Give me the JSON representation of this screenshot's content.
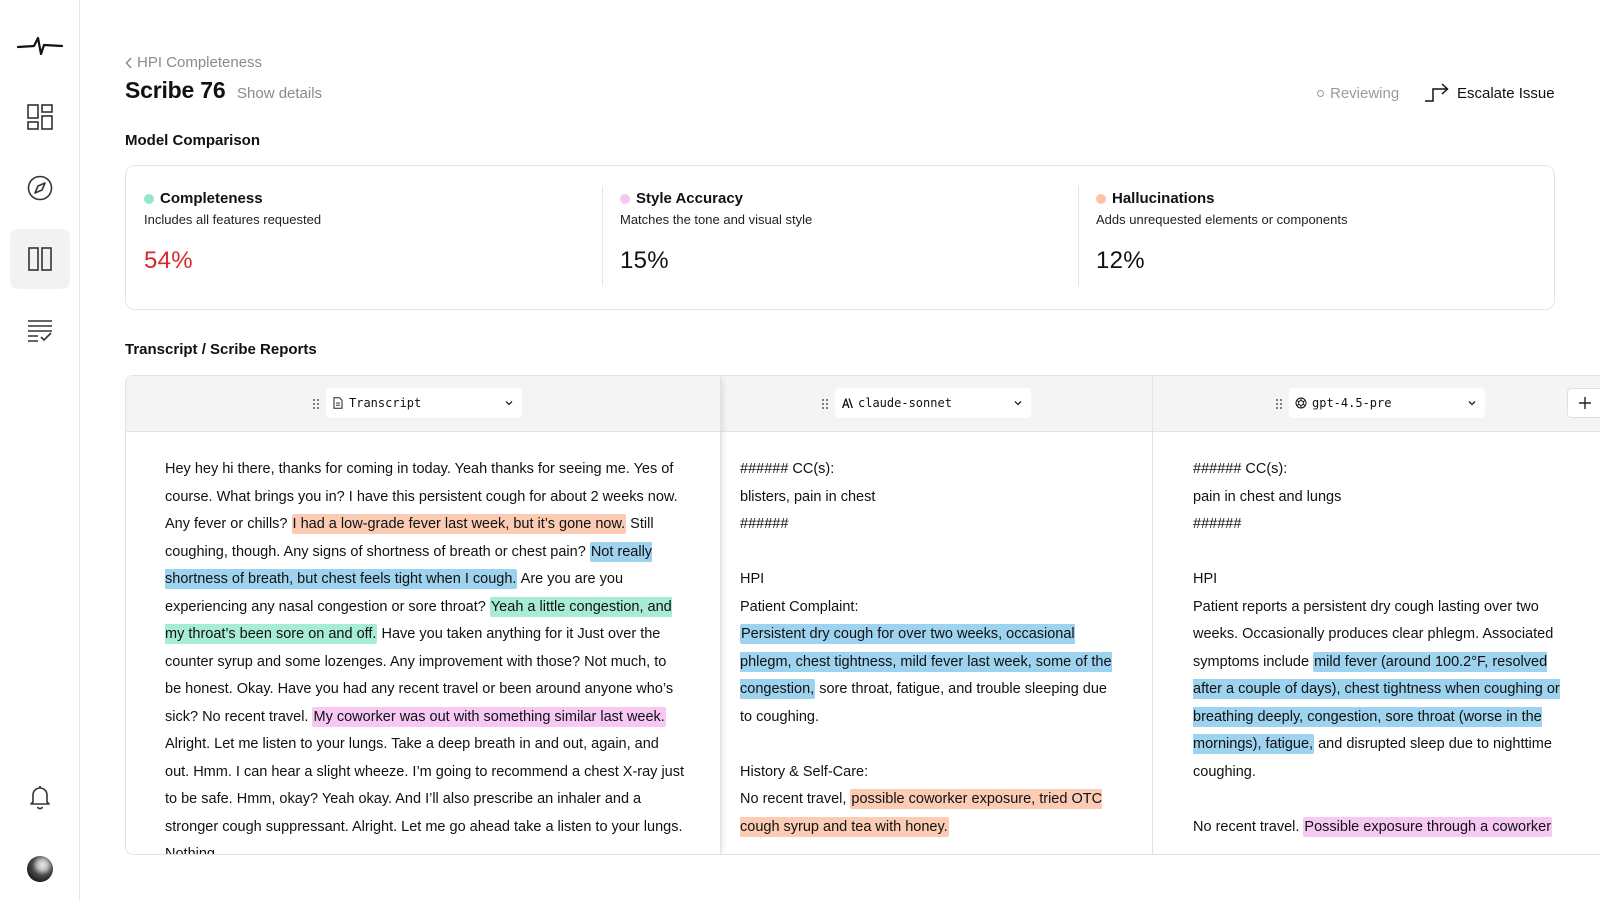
{
  "sidebar": {
    "items": [
      {
        "name": "dashboard-icon"
      },
      {
        "name": "compass-icon"
      },
      {
        "name": "columns-icon",
        "active": true
      },
      {
        "name": "checklist-icon"
      }
    ],
    "bottom": [
      {
        "name": "bell-icon"
      },
      {
        "name": "avatar"
      }
    ]
  },
  "header": {
    "breadcrumb": "HPI Completeness",
    "title": "Scribe 76",
    "show_details": "Show details",
    "status": "Reviewing",
    "escalate": "Escalate Issue"
  },
  "comparison": {
    "title": "Model Comparison",
    "metrics": [
      {
        "name": "Completeness",
        "desc": "Includes all features requested",
        "value": "54%",
        "dot": "#8fe9cf",
        "value_color": "#d42a2a"
      },
      {
        "name": "Style Accuracy",
        "desc": "Matches the tone and visual style",
        "value": "15%",
        "dot": "#f5c7f1",
        "value_color": "#111111"
      },
      {
        "name": "Hallucinations",
        "desc": "Adds unrequested elements or components",
        "value": "12%",
        "dot": "#fbc3a8",
        "value_color": "#111111"
      }
    ]
  },
  "reports": {
    "title": "Transcript / Scribe Reports",
    "columns": [
      {
        "label": "Transcript",
        "icon": "document-icon"
      },
      {
        "label": "claude-sonnet",
        "icon": "anthropic-icon"
      },
      {
        "label": "gpt-4.5-pre",
        "icon": "openai-icon"
      }
    ],
    "transcript": [
      {
        "t": "Hey hey hi there, thanks for coming in today. Yeah thanks for seeing me. Yes of course. What brings you in? I have this persistent cough for about 2 weeks now. Any fever or chills? "
      },
      {
        "t": "I had a low-grade fever last week, but it’s gone now.",
        "h": "orange"
      },
      {
        "t": " Still coughing, though. Any signs of shortness of breath or chest pain? "
      },
      {
        "t": "Not really shortness of breath, but chest feels tight when I cough.",
        "h": "blue"
      },
      {
        "t": " Are you are you experiencing any nasal congestion or sore throat? "
      },
      {
        "t": "Yeah a little congestion, and my throat’s been sore on and off.",
        "h": "green"
      },
      {
        "t": " Have you taken anything for it Just over the counter syrup and some lozenges. Any improvement with those? Not much, to be honest. Okay. Have you had any recent travel or been around anyone who’s sick? No recent travel. "
      },
      {
        "t": "My coworker was out with something similar last week.",
        "h": "pink"
      },
      {
        "t": " Alright. Let me listen to your lungs. Take a deep breath in and out, again, and out. Hmm. I can hear a slight wheeze. I’m going to recommend a chest X-ray just to be safe. Hmm, okay? Yeah okay. And I’ll also prescribe an inhaler and a stronger cough suppressant. Alright. Let me go ahead take a listen to your lungs. Nothing"
      }
    ],
    "claude": {
      "cc_head": "###### CC(s):",
      "cc_value": "blisters, pain in chest",
      "cc_end": "######",
      "hpi": "HPI",
      "complaint_label": "Patient Complaint:",
      "complaint": [
        {
          "t": "Persistent dry cough for over two weeks, occasional phlegm, chest tightness, mild fever last week, some of the congestion,",
          "h": "blue"
        },
        {
          "t": " sore throat, fatigue, and trouble sleeping due to coughing."
        }
      ],
      "history_label": "History & Self-Care:",
      "history": [
        {
          "t": "No recent travel, "
        },
        {
          "t": "possible coworker exposure, tried OTC cough syrup and tea with honey.",
          "h": "orange"
        }
      ]
    },
    "gpt": {
      "cc_head": "###### CC(s):",
      "cc_value": "pain in chest and lungs",
      "cc_end": "######",
      "hpi": "HPI",
      "hpi_text": [
        {
          "t": "Patient reports a persistent dry cough lasting over two weeks. Occasionally produces clear phlegm. Associated symptoms include "
        },
        {
          "t": "mild fever (around 100.2°F, resolved after a couple of days), chest tightness when coughing or breathing deeply, congestion, sore throat (worse in the mornings), fatigue,",
          "h": "blue"
        },
        {
          "t": " and disrupted sleep due to nighttime coughing."
        }
      ],
      "travel": [
        {
          "t": "No recent travel. "
        },
        {
          "t": "Possible exposure through a coworker",
          "h": "pink"
        }
      ]
    }
  }
}
